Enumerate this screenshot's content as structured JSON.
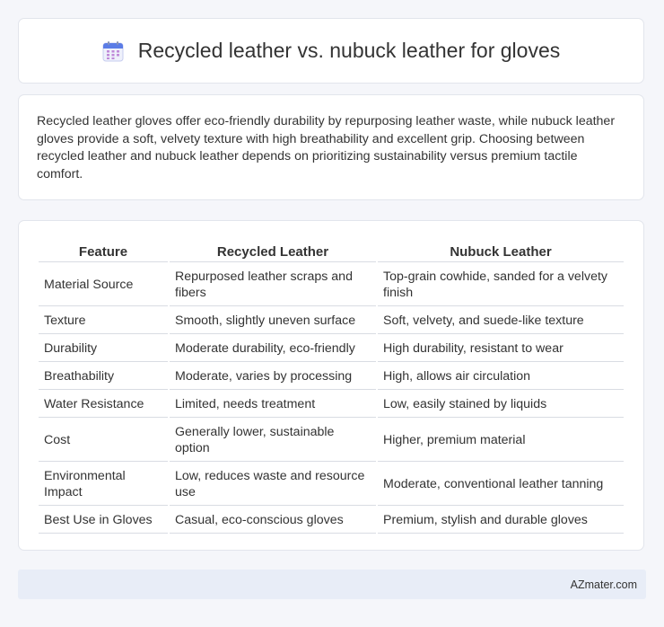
{
  "header": {
    "icon": "calendar-icon",
    "title": "Recycled leather vs. nubuck leather for gloves"
  },
  "intro": {
    "text": "Recycled leather gloves offer eco-friendly durability by repurposing leather waste, while nubuck leather gloves provide a soft, velvety texture with high breathability and excellent grip. Choosing between recycled leather and nubuck leather depends on prioritizing sustainability versus premium tactile comfort."
  },
  "table": {
    "headers": [
      "Feature",
      "Recycled Leather",
      "Nubuck Leather"
    ],
    "rows": [
      [
        "Material Source",
        "Repurposed leather scraps and fibers",
        "Top-grain cowhide, sanded for a velvety finish"
      ],
      [
        "Texture",
        "Smooth, slightly uneven surface",
        "Soft, velvety, and suede-like texture"
      ],
      [
        "Durability",
        "Moderate durability, eco-friendly",
        "High durability, resistant to wear"
      ],
      [
        "Breathability",
        "Moderate, varies by processing",
        "High, allows air circulation"
      ],
      [
        "Water Resistance",
        "Limited, needs treatment",
        "Low, easily stained by liquids"
      ],
      [
        "Cost",
        "Generally lower, sustainable option",
        "Higher, premium material"
      ],
      [
        "Environmental Impact",
        "Low, reduces waste and resource use",
        "Moderate, conventional leather tanning"
      ],
      [
        "Best Use in Gloves",
        "Casual, eco-conscious gloves",
        "Premium, stylish and durable gloves"
      ]
    ]
  },
  "footer": {
    "brand": "AZmater.com"
  }
}
